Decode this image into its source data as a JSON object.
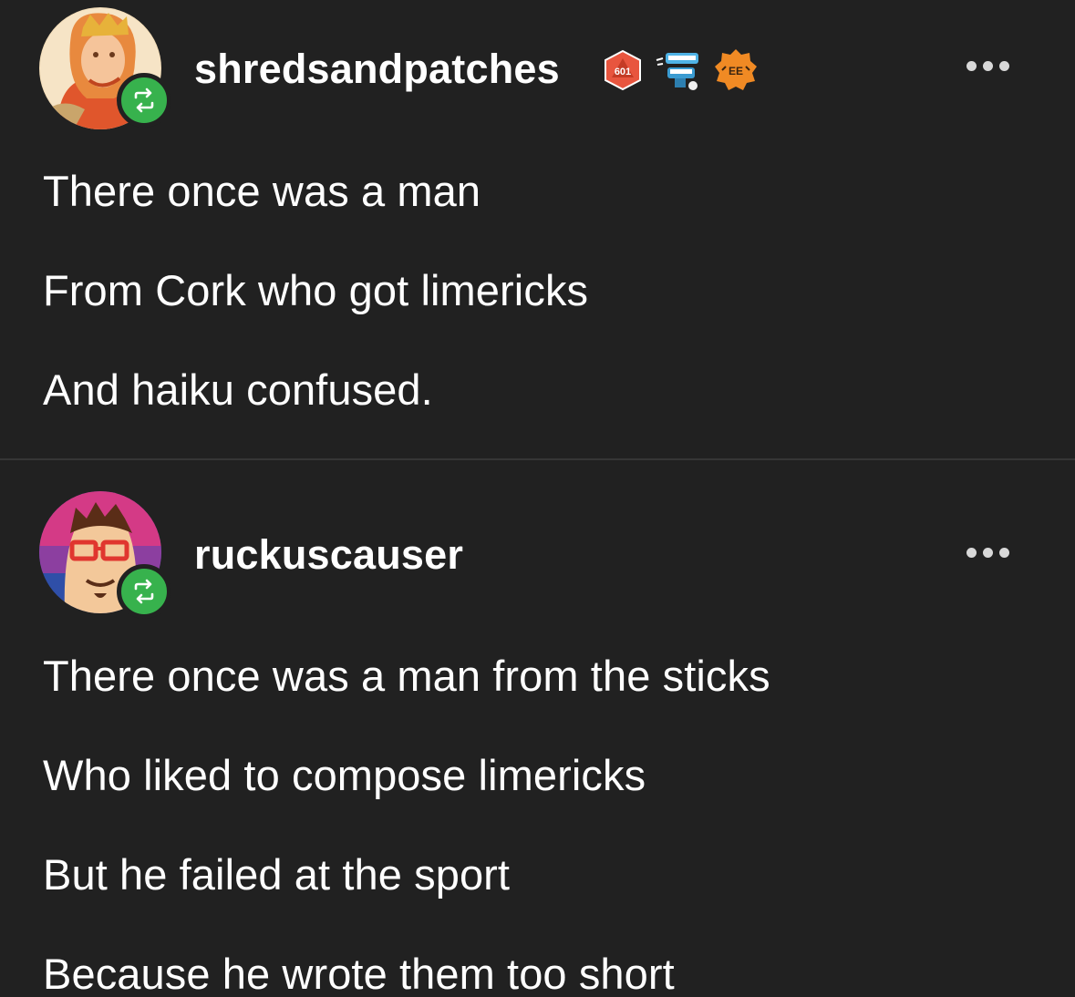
{
  "posts": [
    {
      "username": "shredsandpatches",
      "avatar_icon": "king-portrait-avatar",
      "reblog_icon": "reblog-icon",
      "badges": [
        {
          "icon": "d20-die-badge-icon",
          "text": "601",
          "color": "#e8553e"
        },
        {
          "icon": "chattering-teeth-badge-icon",
          "color": "#4fb3e6"
        },
        {
          "icon": "orange-seal-badge-icon",
          "text": "EE",
          "color": "#f08a24"
        }
      ],
      "lines": [
        "There once was a man",
        "From Cork who got limericks",
        "And haiku confused."
      ]
    },
    {
      "username": "ruckuscauser",
      "avatar_icon": "glasses-man-avatar",
      "reblog_icon": "reblog-icon",
      "lines": [
        "There once was a man from the sticks",
        "Who liked to compose limericks",
        "But he failed at the sport",
        "Because he wrote them too short"
      ]
    }
  ],
  "colors": {
    "background": "#212121",
    "text": "#ffffff",
    "reblog_green": "#37b24d",
    "divider": "#363636"
  }
}
